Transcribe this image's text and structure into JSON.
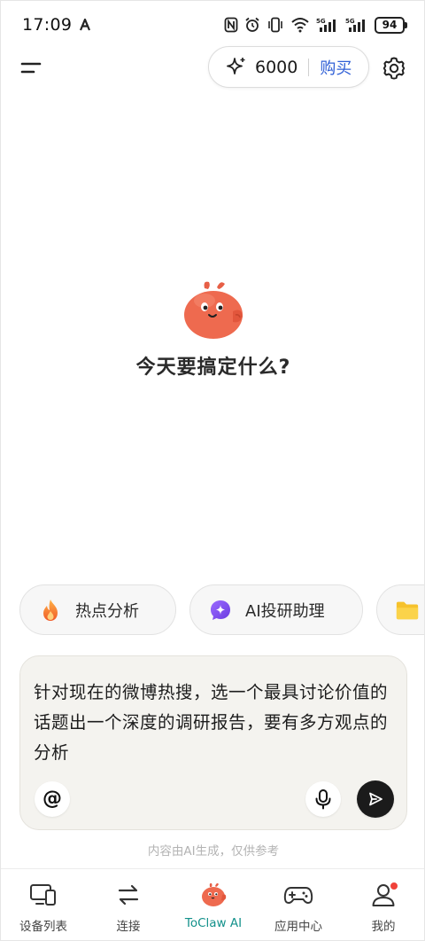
{
  "status_bar": {
    "time": "17:09",
    "battery": "94",
    "network_1": "5G",
    "network_2": "5G"
  },
  "header": {
    "credits": "6000",
    "buy_label": "购买"
  },
  "hero": {
    "title": "今天要搞定什么?"
  },
  "suggestions": [
    {
      "label": "热点分析",
      "icon": "fire-icon"
    },
    {
      "label": "AI投研助理",
      "icon": "sparkle-icon"
    },
    {
      "label": "",
      "icon": "folder-icon"
    }
  ],
  "input": {
    "value": "针对现在的微博热搜，选一个最具讨论价值的话题出一个深度的调研报告，要有多方观点的分析"
  },
  "disclaimer": "内容由AI生成，仅供参考",
  "nav": {
    "items": [
      {
        "label": "设备列表",
        "icon": "devices-icon"
      },
      {
        "label": "连接",
        "icon": "transfer-icon"
      },
      {
        "label": "ToClaw AI",
        "icon": "mascot-icon",
        "active": true
      },
      {
        "label": "应用中心",
        "icon": "gamepad-icon"
      },
      {
        "label": "我的",
        "icon": "profile-icon",
        "badge": true
      }
    ]
  },
  "colors": {
    "accent_link": "#2f5fd6",
    "active_tab": "#13918b",
    "mascot": "#ee6a4f",
    "send_button": "#1b1b1b",
    "badge": "#f0423a"
  }
}
